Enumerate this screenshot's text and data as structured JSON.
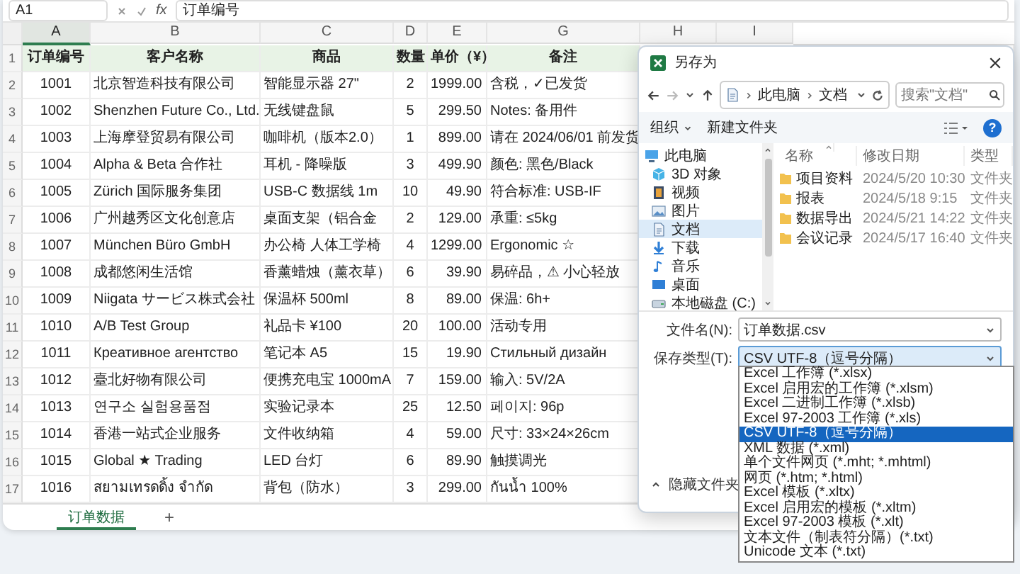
{
  "formula_bar": {
    "name_box": "A1",
    "function_label": "fx",
    "formula": "订单编号"
  },
  "sheet": {
    "columns": [
      {
        "label": "A",
        "selected": true
      },
      {
        "label": "B",
        "selected": false
      },
      {
        "label": "C",
        "selected": false
      },
      {
        "label": "D",
        "selected": false
      },
      {
        "label": "E",
        "selected": false
      },
      {
        "label": "G",
        "selected": false
      },
      {
        "label": "H",
        "selected": false
      },
      {
        "label": "I",
        "selected": false
      }
    ],
    "rows": [
      {
        "number": "1",
        "kind": "header",
        "cells": [
          "订单编号",
          "客户名称",
          "商品",
          "数量",
          "单价（¥）",
          "备注"
        ]
      },
      {
        "number": "2",
        "kind": "data",
        "cells": [
          "1001",
          "北京智造科技有限公司",
          "智能显示器 27\"",
          "2",
          "1999.00",
          "含税，✓已发货"
        ]
      },
      {
        "number": "3",
        "kind": "data",
        "cells": [
          "1002",
          "Shenzhen Future Co., Ltd.",
          "无线键盘鼠",
          "5",
          "299.50",
          "Notes: 备用件"
        ]
      },
      {
        "number": "4",
        "kind": "data",
        "cells": [
          "1003",
          "上海摩登贸易有限公司",
          "咖啡机（版本2.0）",
          "1",
          "899.00",
          "请在 2024/06/01 前发货"
        ]
      },
      {
        "number": "5",
        "kind": "data",
        "cells": [
          "1004",
          "Alpha & Beta 合作社",
          "耳机 - 降噪版",
          "3",
          "499.90",
          "颜色: 黑色/Black"
        ]
      },
      {
        "number": "6",
        "kind": "data",
        "cells": [
          "1005",
          "Zürich 国际服务集团",
          "USB-C 数据线 1m",
          "10",
          "49.90",
          "符合标准: USB-IF"
        ]
      },
      {
        "number": "7",
        "kind": "data",
        "cells": [
          "1006",
          "广州越秀区文化创意店",
          "桌面支架（铝合金",
          "2",
          "129.00",
          "承重: ≤5kg"
        ]
      },
      {
        "number": "8",
        "kind": "data",
        "cells": [
          "1007",
          "München Büro GmbH",
          "办公椅 人体工学椅",
          "4",
          "1299.00",
          "Ergonomic ☆"
        ]
      },
      {
        "number": "9",
        "kind": "data",
        "cells": [
          "1008",
          "成都悠闲生活馆",
          "香薰蜡烛（薰衣草）",
          "6",
          "39.90",
          "易碎品，⚠ 小心轻放"
        ]
      },
      {
        "number": "10",
        "kind": "data",
        "cells": [
          "1009",
          "Niigata サービス株式会社",
          "保温杯 500ml",
          "8",
          "89.00",
          "保温: 6h+"
        ]
      },
      {
        "number": "11",
        "kind": "data",
        "cells": [
          "1010",
          "A/B Test Group",
          "礼品卡 ¥100",
          "20",
          "100.00",
          "活动专用"
        ]
      },
      {
        "number": "12",
        "kind": "data",
        "cells": [
          "1011",
          "Креативное агентство",
          "笔记本 A5",
          "15",
          "19.90",
          "Стильный дизайн"
        ]
      },
      {
        "number": "13",
        "kind": "data",
        "cells": [
          "1012",
          "臺北好物有限公司",
          "便携充电宝 1000mA",
          "7",
          "159.00",
          "输入: 5V/2A"
        ]
      },
      {
        "number": "14",
        "kind": "data",
        "cells": [
          "1013",
          "연구소 실험용품점",
          "实验记录本",
          "25",
          "12.50",
          "페이지: 96p"
        ]
      },
      {
        "number": "15",
        "kind": "data",
        "cells": [
          "1014",
          "香港一站式企业服务",
          "文件收纳箱",
          "4",
          "59.00",
          "尺寸: 33×24×26cm"
        ]
      },
      {
        "number": "16",
        "kind": "data",
        "cells": [
          "1015",
          "Global ★ Trading",
          "LED 台灯",
          "6",
          "89.90",
          "触摸调光"
        ]
      },
      {
        "number": "17",
        "kind": "data",
        "cells": [
          "1016",
          "สยามเทรดดิ้ง จำกัด",
          "背包（防水）",
          "3",
          "299.00",
          "กันน้ำ 100%"
        ]
      }
    ],
    "tabs": [
      {
        "label": "订单数据",
        "selected": true
      }
    ],
    "add_tab": "+"
  },
  "dialog": {
    "title": "另存为",
    "address": [
      "此电脑",
      "文档"
    ],
    "search": {
      "placeholder": "搜索\"文档\""
    },
    "toolbar": {
      "organize": "组织",
      "new_folder": "新建文件夹",
      "help": "?"
    },
    "tree": [
      {
        "label": "此电脑",
        "kind": "computer",
        "selected": false,
        "children": [
          {
            "label": "3D 对象",
            "kind": "cube",
            "selected": false
          },
          {
            "label": "视频",
            "kind": "video",
            "selected": false
          },
          {
            "label": "图片",
            "kind": "picture",
            "selected": false
          },
          {
            "label": "文档",
            "kind": "document",
            "selected": true
          },
          {
            "label": "下载",
            "kind": "download",
            "selected": false
          },
          {
            "label": "音乐",
            "kind": "music",
            "selected": false
          },
          {
            "label": "桌面",
            "kind": "desktop",
            "selected": false
          },
          {
            "label": "本地磁盘 (C:)",
            "kind": "drive",
            "selected": false
          }
        ]
      }
    ],
    "file_columns": [
      "名称",
      "修改日期",
      "类型"
    ],
    "files": [
      {
        "name": "项目资料",
        "modified": "2024/5/20 10:30",
        "type": "文件夹"
      },
      {
        "name": "报表",
        "modified": "2024/5/18 9:15",
        "type": "文件夹"
      },
      {
        "name": "数据导出",
        "modified": "2024/5/21 14:22",
        "type": "文件夹"
      },
      {
        "name": "会议记录",
        "modified": "2024/5/17 16:40",
        "type": "文件夹"
      }
    ],
    "filename_label": "文件名(N):",
    "filename": "订单数据.csv",
    "filetype_label": "保存类型(T):",
    "filetype": "CSV UTF-8（逗号分隔）",
    "filetype_options": [
      {
        "label": "Excel 工作簿 (*.xlsx)",
        "selected": false
      },
      {
        "label": "Excel 启用宏的工作簿 (*.xlsm)",
        "selected": false
      },
      {
        "label": "Excel 二进制工作簿 (*.xlsb)",
        "selected": false
      },
      {
        "label": "Excel 97-2003 工作簿 (*.xls)",
        "selected": false
      },
      {
        "label": "CSV UTF-8（逗号分隔）",
        "selected": true
      },
      {
        "label": "XML 数据 (*.xml)",
        "selected": false
      },
      {
        "label": "单个文件网页 (*.mht; *.mhtml)",
        "selected": false
      },
      {
        "label": "网页 (*.htm; *.html)",
        "selected": false
      },
      {
        "label": "Excel 模板 (*.xltx)",
        "selected": false
      },
      {
        "label": "Excel 启用宏的模板 (*.xltm)",
        "selected": false
      },
      {
        "label": "Excel 97-2003 模板 (*.xlt)",
        "selected": false
      },
      {
        "label": "文本文件（制表符分隔）(*.txt)",
        "selected": false
      },
      {
        "label": "Unicode 文本 (*.txt)",
        "selected": false
      }
    ],
    "hide_folders": "隐藏文件夹"
  }
}
